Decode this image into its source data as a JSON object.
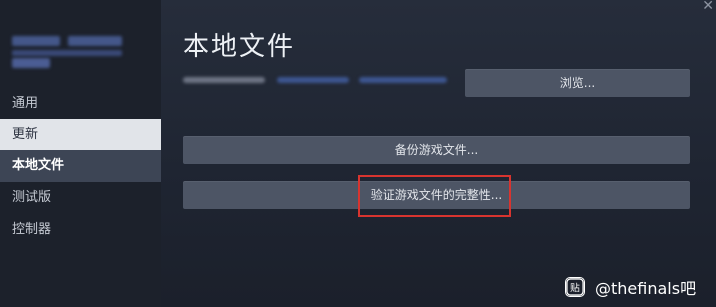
{
  "window": {
    "close_glyph": "✕"
  },
  "sidebar": {
    "items": [
      {
        "label": "通用"
      },
      {
        "label": "更新"
      },
      {
        "label": "本地文件"
      },
      {
        "label": "测试版"
      },
      {
        "label": "控制器"
      }
    ],
    "hovered_item": "更新",
    "active_item": "本地文件"
  },
  "main": {
    "title": "本地文件",
    "browse_label": "浏览...",
    "backup_label": "备份游戏文件...",
    "verify_label": "验证游戏文件的完整性..."
  },
  "watermark": {
    "logo_glyph": "贴",
    "text": "@thefinals吧"
  },
  "colors": {
    "background": "#1e2430",
    "sidebar": "#1c212b",
    "button": "#4d5565",
    "highlight": "#d8342f",
    "active_item": "#3d4555",
    "hover_item": "#e1e4e9"
  }
}
